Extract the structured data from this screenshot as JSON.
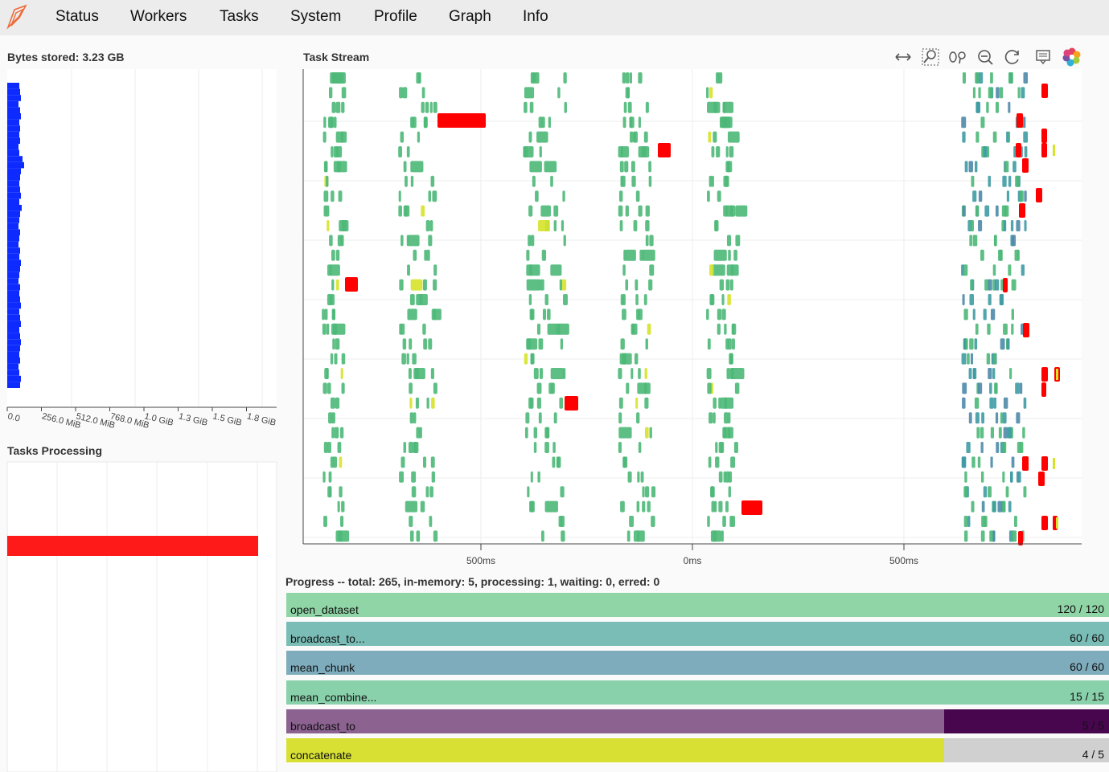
{
  "nav": {
    "items": [
      "Status",
      "Workers",
      "Tasks",
      "System",
      "Profile",
      "Graph",
      "Info"
    ]
  },
  "bytes_panel": {
    "title": "Bytes stored: 3.23 GB",
    "ticks": [
      "0.0",
      "256.0 MiB",
      "512.0 MiB",
      "768.0 MiB",
      "1.0 GiB",
      "1.3 GiB",
      "1.5 GiB",
      "1.8 GiB"
    ]
  },
  "tasks_processing": {
    "title": "Tasks Processing"
  },
  "task_stream": {
    "title": "Task Stream",
    "tick_labels": [
      "500ms",
      "0ms",
      "500ms"
    ],
    "tools": [
      "pan-icon",
      "box-zoom-icon",
      "wheel-zoom-icon",
      "zoom-out-icon",
      "reset-icon",
      "hover-icon",
      "bokeh-logo-icon"
    ],
    "colors": {
      "green": "#4db878",
      "red": "#ff0000",
      "teal": "#3e9ba3",
      "steel": "#4f8aa8",
      "yellow": "#d6e32a"
    }
  },
  "progress": {
    "title": "Progress -- total: 265, in-memory: 5, processing: 1, waiting: 0, erred: 0",
    "rows": [
      {
        "name": "open_dataset",
        "count": "120 / 120",
        "done": 120,
        "total": 120,
        "processing": 0,
        "color": "#8fd5a6",
        "dark": "#3c9a63"
      },
      {
        "name": "broadcast_to...",
        "count": "60 / 60",
        "done": 60,
        "total": 60,
        "processing": 0,
        "color": "#7abdb6",
        "dark": "#2f7f78"
      },
      {
        "name": "mean_chunk",
        "count": "60 / 60",
        "done": 60,
        "total": 60,
        "processing": 0,
        "color": "#7eacbd",
        "dark": "#3c7891"
      },
      {
        "name": "mean_combine...",
        "count": "15 / 15",
        "done": 15,
        "total": 15,
        "processing": 0,
        "color": "#88d1ab",
        "dark": "#3b9a6a"
      },
      {
        "name": "broadcast_to",
        "count": "5 / 5",
        "done": 4,
        "total": 5,
        "processing": 1,
        "color": "#8b6290",
        "dark": "#48064f"
      },
      {
        "name": "concatenate",
        "count": "4 / 5",
        "done": 4,
        "total": 5,
        "processing": 0,
        "color": "#d8e034",
        "dark": "#9aa800"
      }
    ]
  }
}
